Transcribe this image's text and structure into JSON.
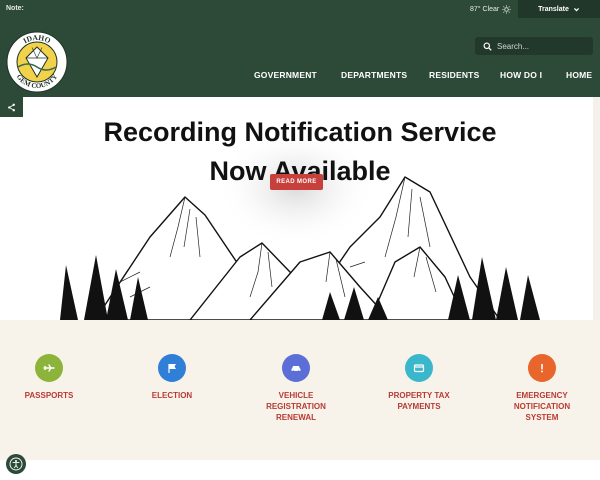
{
  "topbar": {
    "note_label": "Note:",
    "weather": "87° Clear",
    "weather_icon": "sun-icon",
    "translate_label": "Translate"
  },
  "logo": {
    "top_text": "IDAHO",
    "bottom_text": "GEM COUNTY",
    "icon": "gem-county-seal"
  },
  "search": {
    "placeholder": "Search..."
  },
  "nav": {
    "items": [
      "GOVERNMENT",
      "DEPARTMENTS",
      "RESIDENTS",
      "HOW DO I",
      "HOME"
    ]
  },
  "hero": {
    "title_line1": "Recording Notification Service",
    "title_line2": "Now Available",
    "button_label": "READ MORE"
  },
  "quick_links": [
    {
      "label": "PASSPORTS",
      "icon": "airplane-icon",
      "color": "#8cb43a"
    },
    {
      "label": "ELECTION",
      "icon": "flag-icon",
      "color": "#2f7ed8"
    },
    {
      "label": "VEHICLE\nREGISTRATION\nRENEWAL",
      "icon": "car-icon",
      "color": "#5b6fd6"
    },
    {
      "label": "PROPERTY TAX\nPAYMENTS",
      "icon": "payment-card-icon",
      "color": "#3bb7cc"
    },
    {
      "label": "EMERGENCY\nNOTIFICATION\nSYSTEM",
      "icon": "alert-icon",
      "color": "#e8662c"
    }
  ],
  "colors": {
    "header_green": "#2d4a38",
    "accent_red": "#c7403c",
    "quick_bg": "#f7f2ea"
  }
}
